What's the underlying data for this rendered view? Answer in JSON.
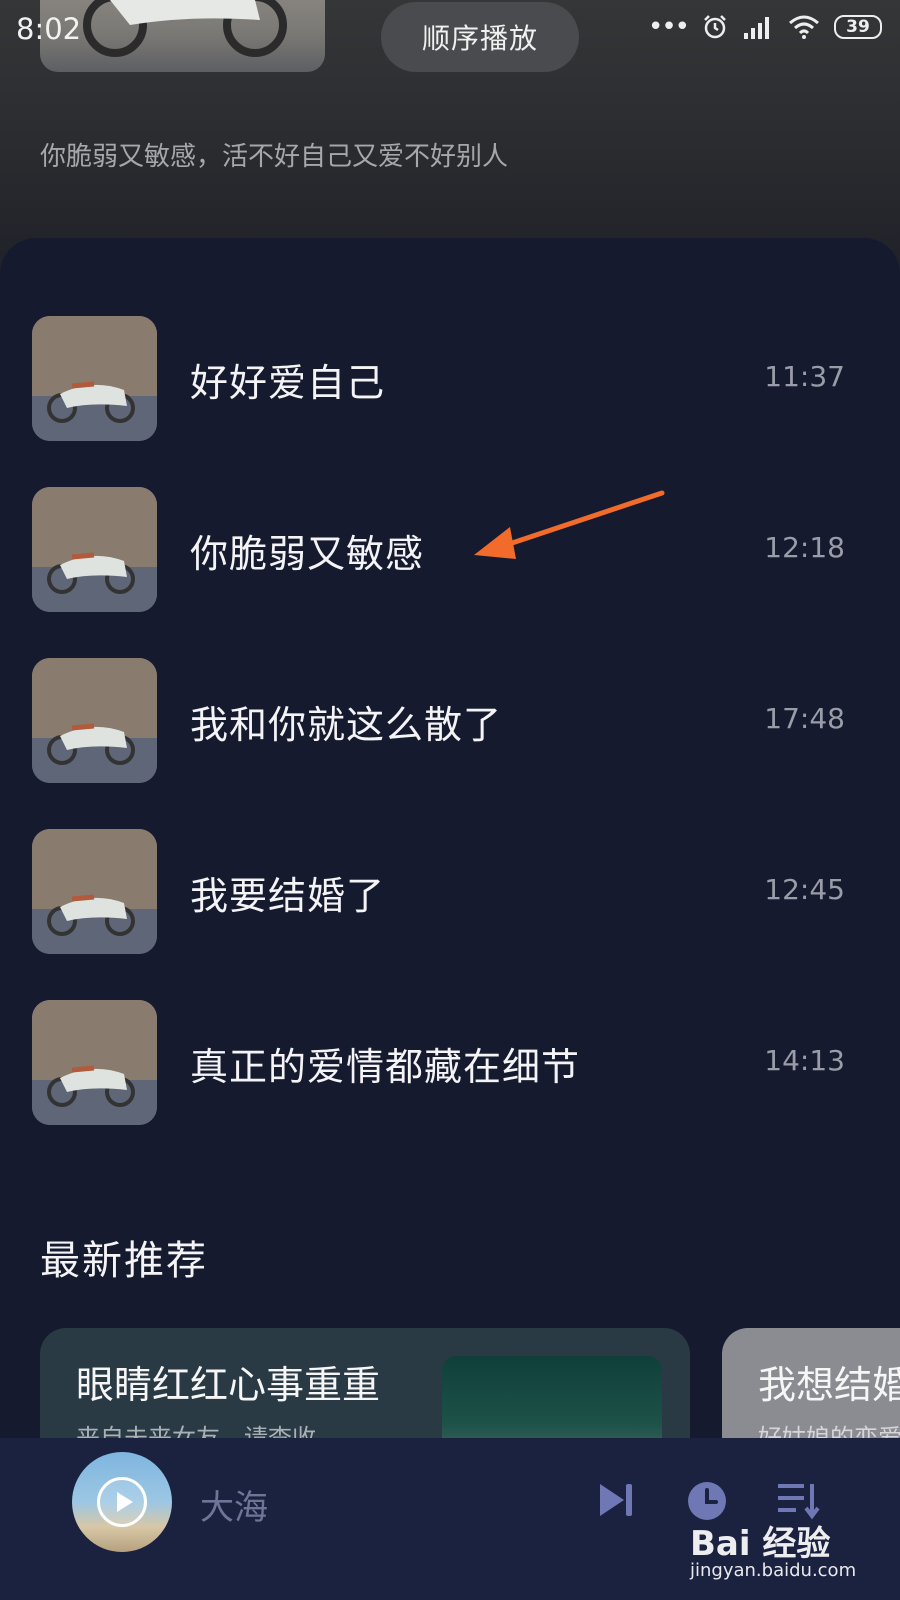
{
  "status_bar": {
    "time": "8:02",
    "more_dots": "•••",
    "battery": "39"
  },
  "header": {
    "play_mode": "顺序播放",
    "album_description": "你脆弱又敏感，活不好自己又爱不好别人"
  },
  "songs": [
    {
      "title": "好好爱自己",
      "duration": "11:37"
    },
    {
      "title": "你脆弱又敏感",
      "duration": "12:18"
    },
    {
      "title": "我和你就这么散了",
      "duration": "17:48"
    },
    {
      "title": "我要结婚了",
      "duration": "12:45"
    },
    {
      "title": "真正的爱情都藏在细节",
      "duration": "14:13"
    }
  ],
  "recommend": {
    "heading": "最新推荐",
    "cards": [
      {
        "title": "眼睛红红心事重重",
        "subtitle": "来自未来女友，请查收"
      },
      {
        "title": "我想结婚",
        "subtitle": "好姑娘的恋爱"
      }
    ]
  },
  "player": {
    "now_playing": "大海"
  },
  "watermark": {
    "logo": "Bai 经验",
    "url": "jingyan.baidu.com"
  },
  "colors": {
    "panel": "#151a2e",
    "player_bar": "#1b2240",
    "arrow": "#f26b2a",
    "accent_icons": "#6f78b5"
  },
  "icons": [
    "alarm-icon",
    "signal-icon",
    "wifi-icon",
    "battery-icon",
    "play-icon",
    "next-icon",
    "timer-icon",
    "playlist-icon"
  ]
}
